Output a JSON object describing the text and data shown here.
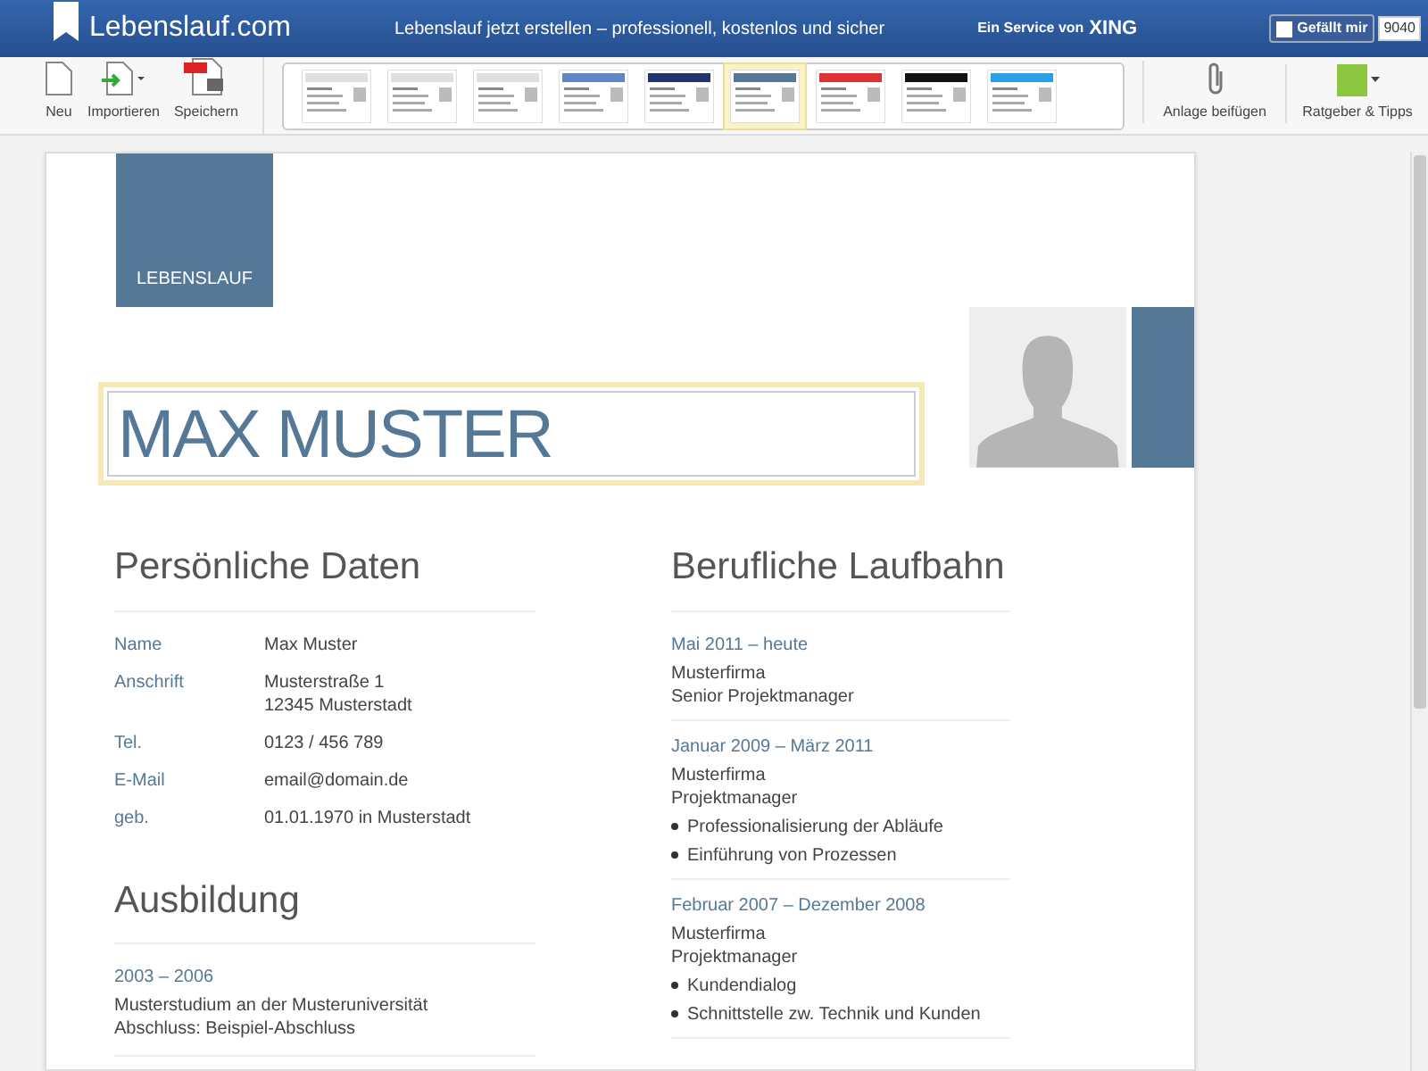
{
  "header": {
    "logo": "Lebenslauf.com",
    "tagline": "Lebenslauf jetzt erstellen – professionell, kostenlos und sicher",
    "service": "Ein Service von",
    "service_brand": "XING",
    "like_label": "Gefällt mir",
    "like_count": "9040"
  },
  "toolbar": {
    "left": [
      {
        "label": "Neu",
        "kind": "new"
      },
      {
        "label": "Importieren",
        "kind": "import"
      },
      {
        "label": "Speichern",
        "kind": "pdf"
      }
    ],
    "templates": [
      {
        "selected": false
      },
      {
        "selected": false
      },
      {
        "selected": false
      },
      {
        "selected": false
      },
      {
        "selected": false
      },
      {
        "selected": true
      },
      {
        "selected": false
      },
      {
        "selected": false
      },
      {
        "selected": false
      }
    ],
    "right": [
      {
        "label": "Anlage beifügen",
        "kind": "attach"
      },
      {
        "label": "Ratgeber & Tipps",
        "kind": "tips"
      }
    ]
  },
  "document": {
    "badge": "LEBENSLAUF",
    "name": "MAX MUSTER",
    "personal": {
      "title": "Persönliche Daten",
      "rows": [
        {
          "label": "Name",
          "value": "Max Muster"
        },
        {
          "label": "Anschrift",
          "value": "Musterstraße 1\n12345 Musterstadt"
        },
        {
          "label": "Tel.",
          "value": "0123 / 456 789"
        },
        {
          "label": "E-Mail",
          "value": "email@domain.de"
        },
        {
          "label": "geb.",
          "value": "01.01.1970 in Musterstadt"
        }
      ]
    },
    "education": {
      "title": "Ausbildung",
      "entries": [
        {
          "date": "2003 – 2006",
          "lines": [
            "Musterstudium an der Musteruniversität",
            "Abschluss: Beispiel-Abschluss"
          ]
        }
      ]
    },
    "career": {
      "title": "Berufliche Laufbahn",
      "entries": [
        {
          "date": "Mai 2011 – heute",
          "lines": [
            "Musterfirma",
            "Senior Projektmanager"
          ]
        },
        {
          "date": "Januar 2009 – März 2011",
          "lines": [
            "Musterfirma",
            "Projektmanager"
          ],
          "bullets": [
            "Professionalisierung der Abläufe",
            "Einführung von Prozessen"
          ]
        },
        {
          "date": "Februar 2007 – Dezember 2008",
          "lines": [
            "Musterfirma",
            "Projektmanager"
          ],
          "bullets": [
            "Kundendialog",
            "Schnittstelle zw. Technik und Kunden"
          ]
        }
      ]
    }
  }
}
